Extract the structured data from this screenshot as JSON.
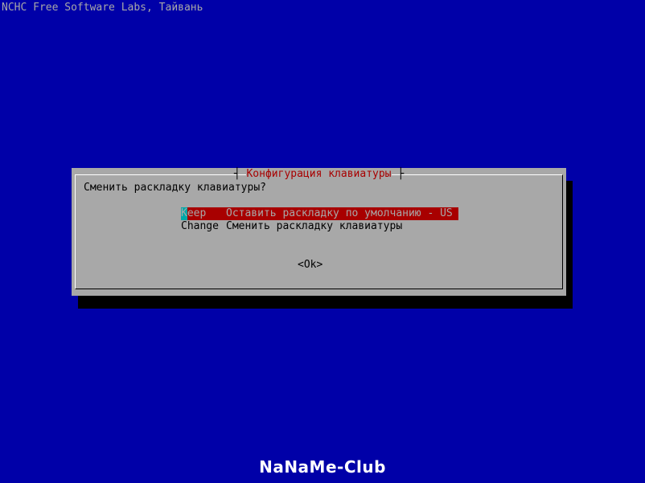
{
  "screen": {
    "backtitle": "NCHC Free Software Labs, Тайвань",
    "colors": {
      "background": "#0000a8",
      "dialog": "#a8a8a8",
      "title_text": "#a80000",
      "selection": "#a80000",
      "cursor": "#00a8a8"
    }
  },
  "dialog": {
    "title": "Конфигурация клавиатуры",
    "question": "Сменить раскладку клавиатуры?",
    "menu": [
      {
        "tag_first": "K",
        "tag_rest": "eep",
        "description": "Оставить раскладку по умолчанию - US",
        "selected": true
      },
      {
        "tag_first": "C",
        "tag_rest": "hange",
        "description": "Сменить раскладку клавиатуры",
        "selected": false
      }
    ],
    "ok_button": "<Ok>"
  },
  "watermark": {
    "text": "NaNaMe-Club"
  }
}
